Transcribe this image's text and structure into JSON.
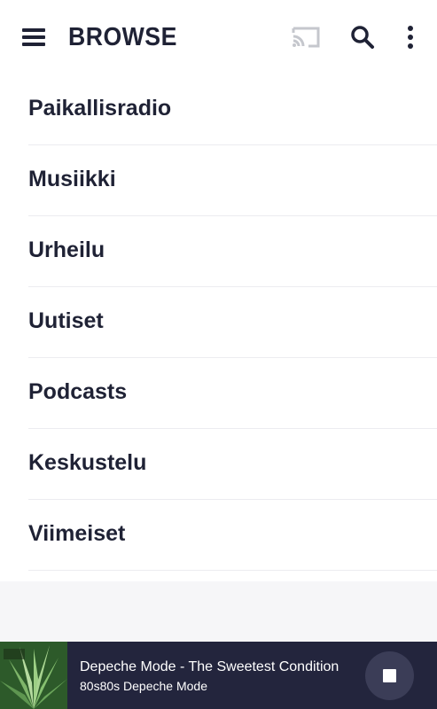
{
  "header": {
    "title": "BROWSE",
    "menu_icon": "hamburger-menu-icon",
    "cast_icon": "cast-icon",
    "search_icon": "search-icon",
    "more_icon": "more-vertical-icon"
  },
  "browse": {
    "items": [
      {
        "label": "Paikallisradio"
      },
      {
        "label": "Musiikki"
      },
      {
        "label": "Urheilu"
      },
      {
        "label": "Uutiset"
      },
      {
        "label": "Podcasts"
      },
      {
        "label": "Keskustelu"
      },
      {
        "label": "Viimeiset"
      }
    ]
  },
  "now_playing": {
    "title": "Depeche Mode - The Sweetest Condition",
    "subtitle": "80s80s Depeche Mode",
    "cover_icon": "album-cover-image",
    "stop_icon": "stop-icon"
  },
  "colors": {
    "text_dark": "#1f2235",
    "player_bg": "#23253d",
    "stop_button_bg": "#3b3d57",
    "cast_icon": "#c5c7cd"
  }
}
